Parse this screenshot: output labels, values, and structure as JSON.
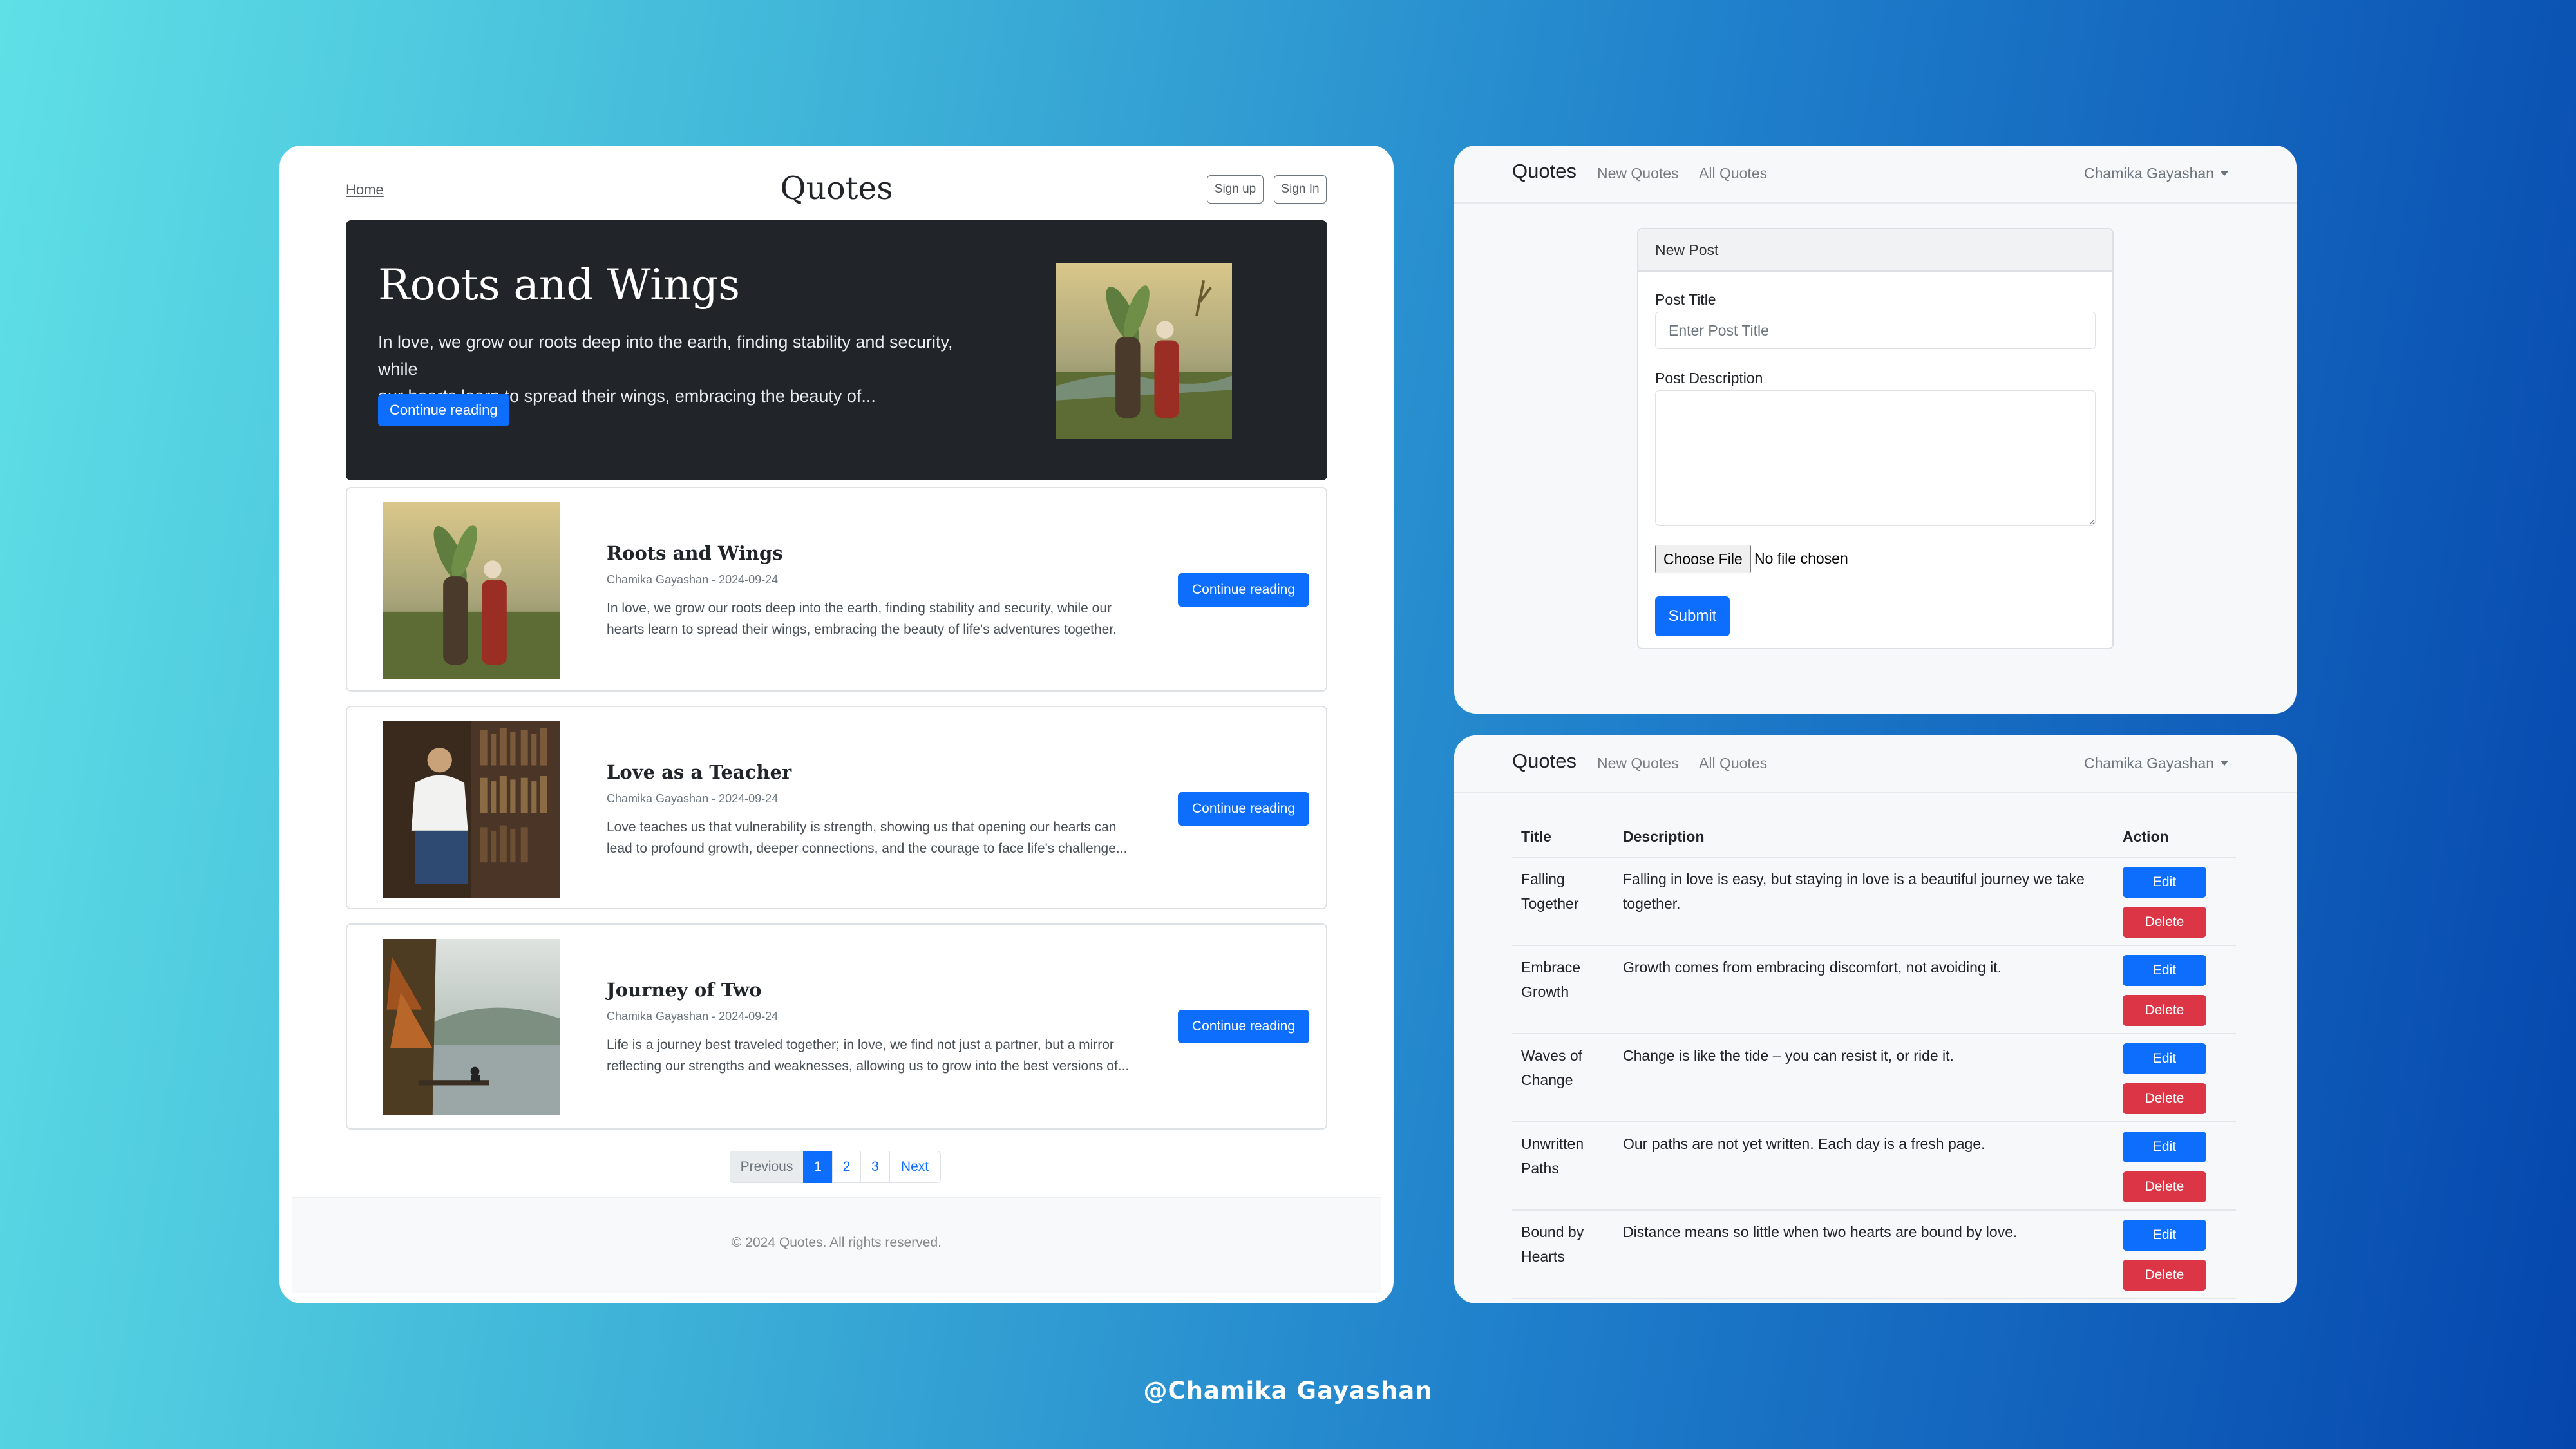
{
  "blog": {
    "home_link": "Home",
    "site_title": "Quotes",
    "signup_label": "Sign up",
    "signin_label": "Sign In",
    "hero": {
      "title": "Roots and Wings",
      "text_line1": "In love, we grow our roots deep into the earth, finding stability and security, while",
      "text_line2": "our hearts learn to spread their wings, embracing the beauty of...",
      "button": "Continue reading"
    },
    "posts": [
      {
        "title": "Roots and Wings",
        "meta": "Chamika Gayashan - 2024-09-24",
        "line1": "In love, we grow our roots deep into the earth, finding stability and security, while our",
        "line2": "hearts learn to spread their wings, embracing the beauty of life's adventures together.",
        "button": "Continue reading"
      },
      {
        "title": "Love as a Teacher",
        "meta": "Chamika Gayashan - 2024-09-24",
        "line1": "Love teaches us that vulnerability is strength, showing us that opening our hearts can",
        "line2": "lead to profound growth, deeper connections, and the courage to face life's challenge...",
        "button": "Continue reading"
      },
      {
        "title": "Journey of Two",
        "meta": "Chamika Gayashan - 2024-09-24",
        "line1": "Life is a journey best traveled together; in love, we find not just a partner, but a mirror",
        "line2": "reflecting our strengths and weaknesses, allowing us to grow into the best versions of...",
        "button": "Continue reading"
      }
    ],
    "pagination": {
      "previous": "Previous",
      "pages": [
        "1",
        "2",
        "3"
      ],
      "next": "Next"
    },
    "footer": "© 2024 Quotes. All rights reserved."
  },
  "navbar": {
    "brand": "Quotes",
    "new_quotes": "New Quotes",
    "all_quotes": "All Quotes",
    "user": "Chamika Gayashan"
  },
  "form": {
    "header": "New Post",
    "title_label": "Post Title",
    "title_placeholder": "Enter Post Title",
    "desc_label": "Post Description",
    "file_button": "Choose File",
    "file_status": "No file chosen",
    "submit": "Submit"
  },
  "table": {
    "headers": {
      "title": "Title",
      "description": "Description",
      "action": "Action"
    },
    "edit_label": "Edit",
    "delete_label": "Delete",
    "rows": [
      {
        "title_l1": "Falling",
        "title_l2": "Together",
        "desc": "Falling in love is easy, but staying in love is a beautiful journey we take together."
      },
      {
        "title_l1": "Embrace",
        "title_l2": "Growth",
        "desc": "Growth comes from embracing discomfort, not avoiding it."
      },
      {
        "title_l1": "Waves of",
        "title_l2": "Change",
        "desc": "Change is like the tide – you can resist it, or ride it."
      },
      {
        "title_l1": "Unwritten",
        "title_l2": "Paths",
        "desc": "Our paths are not yet written. Each day is a fresh page."
      },
      {
        "title_l1": "Bound by",
        "title_l2": "Hearts",
        "desc": "Distance means so little when two hearts are bound by love."
      }
    ]
  },
  "credit": "@Chamika Gayashan",
  "colors": {
    "primary": "#0d6efd",
    "danger": "#dc3545",
    "hero_bg": "#212529"
  }
}
